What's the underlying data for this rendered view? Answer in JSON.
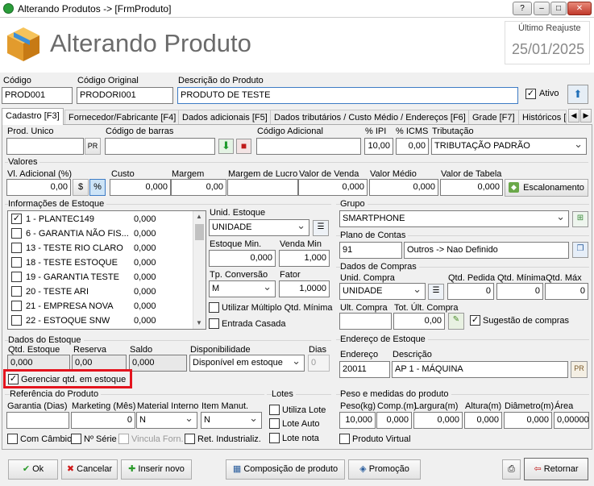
{
  "window": {
    "title": "Alterando Produtos    ->    [FrmProduto]"
  },
  "header": {
    "title": "Alterando Produto",
    "reajuste_label": "Último Reajuste",
    "reajuste_value": "25/01/2025"
  },
  "top": {
    "codigo_label": "Código",
    "codigo": "PROD001",
    "codigo_original_label": "Código Original",
    "codigo_original": "PRODORI001",
    "descricao_label": "Descrição do Produto",
    "descricao": "PRODUTO DE TESTE",
    "ativo_label": "Ativo"
  },
  "tabs": [
    "Cadastro [F3]",
    "Fornecedor/Fabricante [F4]",
    "Dados adicionais [F5]",
    "Dados tributários / Custo Médio / Endereços [F6]",
    "Grade [F7]",
    "Históricos ["
  ],
  "row1": {
    "prod_unico": "Prod. Unico",
    "pr_btn": "PR",
    "codigo_barras": "Código de barras",
    "codigo_adicional": "Código Adicional",
    "ipi_label": "% IPI",
    "ipi": "10,00",
    "icms_label": "% ICMS",
    "icms": "0,00",
    "tributacao_label": "Tributação",
    "tributacao": "TRIBUTAÇÃO PADRÃO"
  },
  "valores": {
    "label": "Valores",
    "vl_adicional_label": "Vl. Adicional (%)",
    "vl_adicional": "0,00",
    "dollar": "$",
    "percent": "%",
    "custo_label": "Custo",
    "custo": "0,000",
    "margem_label": "Margem",
    "margem": "0,00",
    "margem_lucro_label": "Margem de Lucro",
    "margem_lucro": "",
    "valor_venda_label": "Valor de Venda",
    "valor_venda": "0,000",
    "valor_medio_label": "Valor Médio",
    "valor_medio": "0,000",
    "valor_tabela_label": "Valor de Tabela",
    "valor_tabela": "0,000",
    "escalonamento": "Escalonamento"
  },
  "estoque_info": {
    "label": "Informações de Estoque",
    "items": [
      {
        "name": "1 - PLANTEC149",
        "value": "0,000",
        "checked": "✓"
      },
      {
        "name": "6 - GARANTIA NÃO FIS...",
        "value": "0,000",
        "checked": ""
      },
      {
        "name": "13 - TESTE RIO CLARO",
        "value": "0,000",
        "checked": ""
      },
      {
        "name": "18 - TESTE ESTOQUE",
        "value": "0,000",
        "checked": ""
      },
      {
        "name": "19 - GARANTIA TESTE",
        "value": "0,000",
        "checked": ""
      },
      {
        "name": "20 - TESTE ARI",
        "value": "0,000",
        "checked": ""
      },
      {
        "name": "21 - EMPRESA NOVA",
        "value": "0,000",
        "checked": ""
      },
      {
        "name": "22 - ESTOQUE SNW",
        "value": "0,000",
        "checked": ""
      }
    ],
    "unid_label": "Unid. Estoque",
    "unid": "UNIDADE",
    "est_min_label": "Estoque Min.",
    "est_min": "0,000",
    "venda_min_label": "Venda Min",
    "venda_min": "1,000",
    "tp_conv_label": "Tp. Conversão",
    "tp_conv": "M",
    "fator_label": "Fator",
    "fator": "1,0000",
    "multiplo_label": "Utilizar Múltiplo Qtd. Mínima",
    "entrada_label": "Entrada Casada"
  },
  "dados_estoque": {
    "label": "Dados do Estoque",
    "qtd_label": "Qtd. Estoque",
    "qtd": "0,000",
    "reserva_label": "Reserva",
    "reserva": "0,00",
    "saldo_label": "Saldo",
    "saldo": "0,000",
    "disp_label": "Disponibilidade",
    "disp": "Disponível em estoque",
    "dias_label": "Dias",
    "dias": "0",
    "gerenciar_label": "Gerenciar qtd. em estoque"
  },
  "referencia": {
    "label": "Referência do Produto",
    "garantia_label": "Garantia (Dias)",
    "garantia": "",
    "marketing_label": "Marketing (Mês)",
    "marketing": "0",
    "material_label": "Material Interno",
    "material": "N",
    "manut_label": "Item Manut.",
    "manut": "N",
    "cambio_label": "Com Câmbio",
    "serie_label": "Nº Série",
    "vincula_label": "Vincula Forn.",
    "ret_label": "Ret. Industrializ."
  },
  "lotes": {
    "label": "Lotes",
    "utiliza": "Utiliza Lote",
    "auto": "Lote Auto",
    "nota": "Lote nota"
  },
  "grupo": {
    "label": "Grupo",
    "value": "SMARTPHONE"
  },
  "plano": {
    "label": "Plano de Contas",
    "code": "91",
    "desc": "Outros -> Nao Definido"
  },
  "compras": {
    "label": "Dados de Compras",
    "unid_label": "Unid. Compra",
    "unid": "UNIDADE",
    "pedida_label": "Qtd. Pedida",
    "pedida": "0",
    "minima_label": "Qtd. Mínima",
    "minima": "0",
    "max_label": "Qtd. Máx",
    "max": "0",
    "ult_label": "Ult. Compra",
    "ult": "",
    "tot_label": "Tot. Últ. Compra",
    "tot": "0,00",
    "sugestao_label": "Sugestão de compras"
  },
  "endereco": {
    "label": "Endereço de Estoque",
    "end_label": "Endereço",
    "end": "20011",
    "desc_label": "Descrição",
    "desc": "AP 1 - MÁQUINA"
  },
  "peso": {
    "label": "Peso e medidas do produto",
    "kg_label": "Peso(kg)",
    "kg": "10,000",
    "comp_label": "Comp.(m)",
    "comp": "0,000",
    "larg_label": "Largura(m)",
    "larg": "0,000",
    "alt_label": "Altura(m)",
    "alt": "0,000",
    "diam_label": "Diâmetro(m)",
    "diam": "0,000",
    "area_label": "Área",
    "area": "0,00000",
    "virtual_label": "Produto Virtual"
  },
  "footer": {
    "ok": "Ok",
    "cancelar": "Cancelar",
    "inserir": "Inserir novo",
    "composicao": "Composição de produto",
    "promocao": "Promoção",
    "retornar": "Retornar"
  }
}
